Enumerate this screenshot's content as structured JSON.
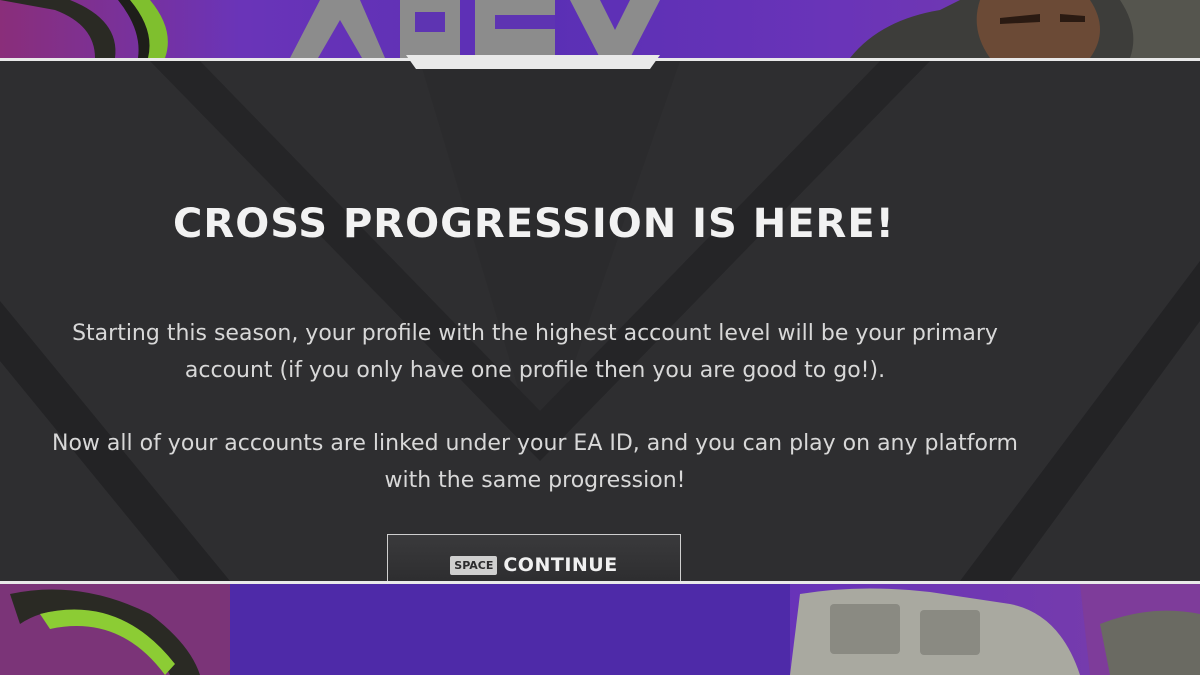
{
  "modal": {
    "title": "CROSS PROGRESSION IS HERE!",
    "paragraphs": [
      "Starting this season, your profile with the highest account level will be your primary account (if you only have one profile then you are good to go!).",
      "Now all of your accounts are linked under your EA ID, and you can play on any platform with the same progression!"
    ],
    "continue_button": {
      "key_hint": "SPACE",
      "label": "CONTINUE"
    }
  },
  "colors": {
    "panel_background": "#2b2b2d",
    "border": "#e9e9e9",
    "background_purple": "#5a2fb5",
    "accent_green": "#9ad03a"
  }
}
